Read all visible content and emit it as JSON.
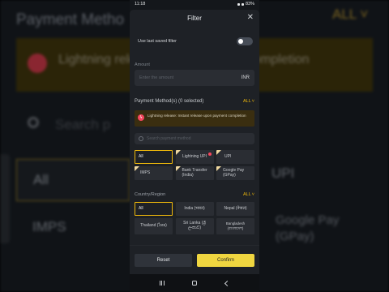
{
  "statusbar": {
    "time": "11:18",
    "battery": "83%"
  },
  "background": {
    "title": "Payment Metho",
    "all": "ALL",
    "banner": "Lightning release  upon payment completion",
    "search": "Search p",
    "chip_all": "All",
    "chip_upi": "UPI",
    "chip_imps": "IMPS",
    "chip_gpay": "Google Pay (GPay)"
  },
  "filter": {
    "title": "Filter",
    "use_last_saved_label": "Use last saved filter",
    "use_last_saved_on": false,
    "amount_label": "Amount",
    "amount_placeholder": "Enter the amount",
    "amount_unit": "INR",
    "payment_methods_label": "Payment Method(s) (0 selected)",
    "payment_all_link": "ALL",
    "notice_text": "Lightning release: Instant release upon payment completion",
    "search_placeholder": "Search payment method",
    "payment_methods": [
      {
        "label": "All",
        "selected": true
      },
      {
        "label": "Lightning UPI",
        "selected": false
      },
      {
        "label": "UPI",
        "selected": false
      },
      {
        "label": "IMPS",
        "selected": false
      },
      {
        "label": "Bank Transfer (India)",
        "selected": false
      },
      {
        "label": "Google Pay (GPay)",
        "selected": false
      }
    ],
    "country_label": "Country/Region",
    "country_all_link": "ALL",
    "countries": [
      {
        "label": "All",
        "selected": true
      },
      {
        "label": "India (भारत)",
        "selected": false
      },
      {
        "label": "Nepal (नेपाल)",
        "selected": false
      },
      {
        "label": "Thailand (ไทย)",
        "selected": false
      },
      {
        "label": "Sri Lanka (ශ්‍රී ලංකාව)",
        "selected": false
      },
      {
        "label": "Bangladesh (বাংলাদেশ)",
        "selected": false
      }
    ],
    "reset_label": "Reset",
    "confirm_label": "Confirm"
  },
  "colors": {
    "accent": "#f0b90b",
    "confirm": "#f0d640",
    "notice_bg": "#3a2e10",
    "danger": "#f6465d"
  },
  "icons": {
    "close": "close-icon",
    "search": "search-icon",
    "lightning": "lightning-icon",
    "chevron": "chevron-down-icon"
  }
}
